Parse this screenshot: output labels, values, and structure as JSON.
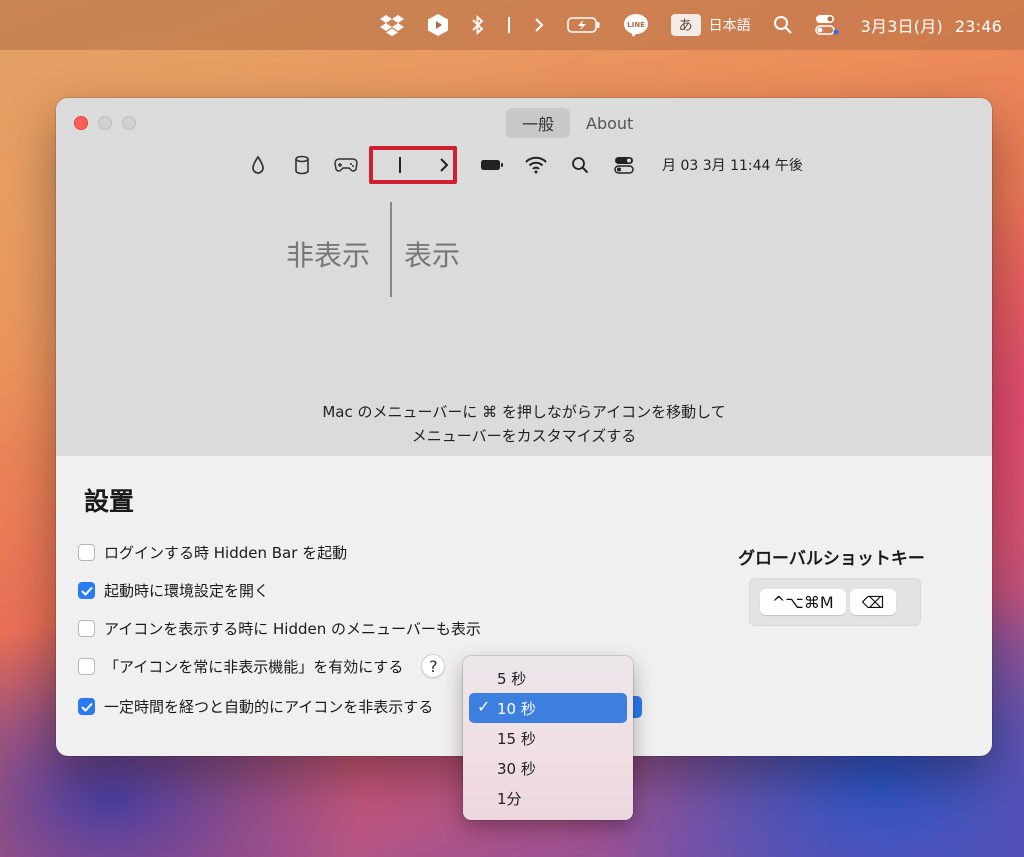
{
  "menubar": {
    "icons": [
      "dropbox-icon",
      "play-icon",
      "bluetooth-icon",
      "separator-icon",
      "chevron-right-icon",
      "battery-icon",
      "line-icon",
      "search-icon",
      "control-center-icon"
    ],
    "ime_char": "あ",
    "ime_label": "日本語",
    "date": "3月3日(月)",
    "time": "23:46"
  },
  "window": {
    "tabs": [
      {
        "label": "一般",
        "active": true
      },
      {
        "label": "About",
        "active": false
      }
    ],
    "preview": {
      "icons": [
        "drop-icon",
        "cylinder-icon",
        "gamepad-icon",
        "separator-icon",
        "chevron-right-icon",
        "battery-icon",
        "wifi-icon",
        "search-icon",
        "control-center-icon"
      ],
      "datetime": "月 03 3月 11:44 午後"
    },
    "label_hide": "非表示",
    "label_show": "表示",
    "instruction_line1": "Mac のメニューバーに ⌘ を押しながらアイコンを移動して",
    "instruction_line2": "メニューバーをカスタマイズする",
    "settings": {
      "title": "設置",
      "options": [
        {
          "label": "ログインする時 Hidden Bar を起動",
          "checked": false
        },
        {
          "label": "起動時に環境設定を開く",
          "checked": true
        },
        {
          "label": "アイコンを表示する時に Hidden のメニューバーも表示",
          "checked": false
        },
        {
          "label": "「アイコンを常に非表示機能」を有効にする",
          "checked": false
        },
        {
          "label": "一定時間を経つと自動的にアイコンを非表示する",
          "checked": true
        }
      ],
      "help_label": "?",
      "shortcut_title": "グローバルショットキー",
      "shortcut_keys": "^⌥⌘M",
      "shortcut_delete": "⌫"
    }
  },
  "dropdown": {
    "options": [
      "5 秒",
      "10 秒",
      "15 秒",
      "30 秒",
      "1分"
    ],
    "selected_index": 1,
    "check": "✓"
  },
  "colors": {
    "accent": "#2b7bf0",
    "highlight_border": "#d0202f",
    "close_light": "#fe5f57"
  }
}
